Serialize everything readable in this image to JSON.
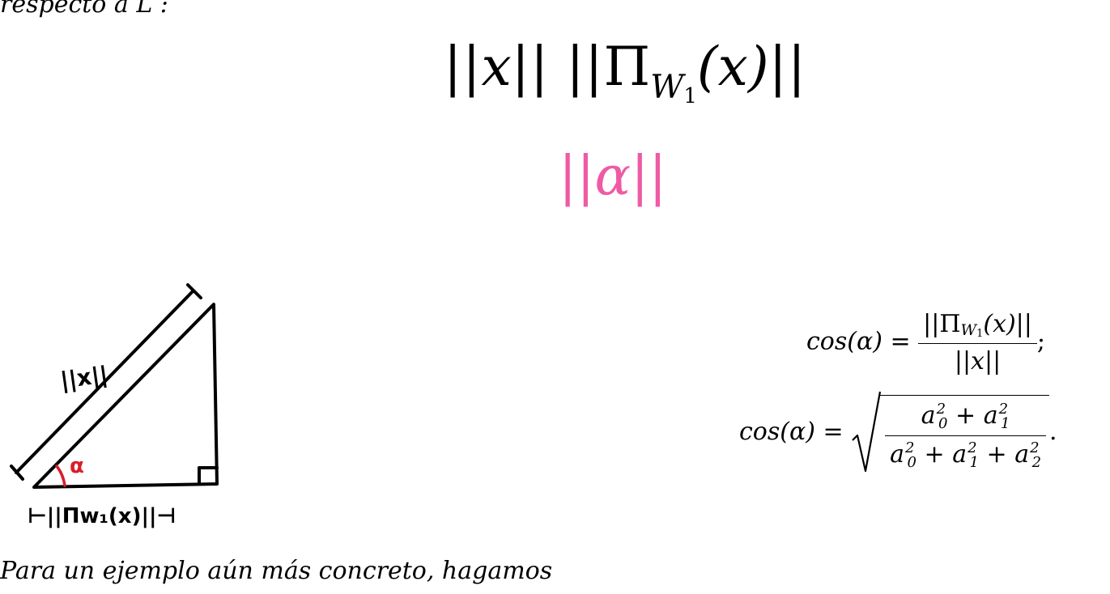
{
  "top_text": "respecto a L :",
  "norms": {
    "bar": "||",
    "x": "x",
    "pi": "Π",
    "w": "W",
    "w_sub": "1",
    "arg": "(x)"
  },
  "alpha_norm": {
    "bars": "||",
    "alpha": "α",
    "color": "#ef5aa4"
  },
  "sketch": {
    "hyp_label": "||x||",
    "base_label": "⊢||Πw₁(x)||⊣",
    "angle_label": "α",
    "angle_color": "#d81e2c"
  },
  "formula1": {
    "lhs": "cos(α) =",
    "num_pre": "||Π",
    "num_w": "W",
    "num_w_sub": "1",
    "num_post": "(x)||",
    "den": "||x||",
    "end": ";"
  },
  "formula2": {
    "lhs": "cos(α) =",
    "num": [
      "a",
      "0",
      "2",
      "+",
      "a",
      "1",
      "2"
    ],
    "den": [
      "a",
      "0",
      "2",
      "+",
      "a",
      "1",
      "2",
      "+",
      "a",
      "2",
      "2"
    ],
    "end": "."
  },
  "bottom_text": "Para un ejemplo aún más concreto, hagamos"
}
